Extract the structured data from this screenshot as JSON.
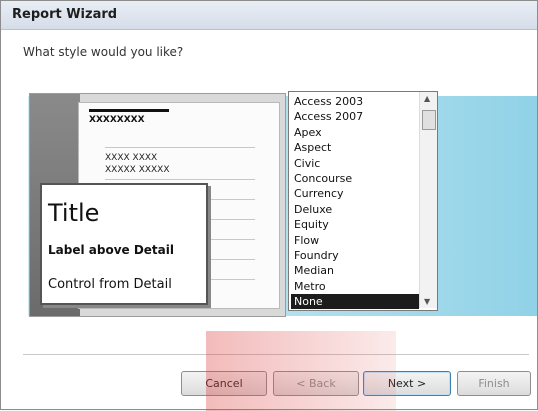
{
  "window": {
    "title": "Report Wizard"
  },
  "prompt": "What style would you like?",
  "preview": {
    "header_placeholder": "XXXXXXXX",
    "row1": "XXXX XXXX",
    "row2": "XXXXX XXXXX",
    "popup_title": "Title",
    "popup_label": "Label above Detail",
    "popup_control": "Control from Detail"
  },
  "styles": {
    "items": [
      "Access 2003",
      "Access 2007",
      "Apex",
      "Aspect",
      "Civic",
      "Concourse",
      "Currency",
      "Deluxe",
      "Equity",
      "Flow",
      "Foundry",
      "Median",
      "Metro",
      "None"
    ],
    "selected": "None"
  },
  "buttons": {
    "cancel": "Cancel",
    "back": "< Back",
    "next": "Next >",
    "finish": "Finish"
  }
}
